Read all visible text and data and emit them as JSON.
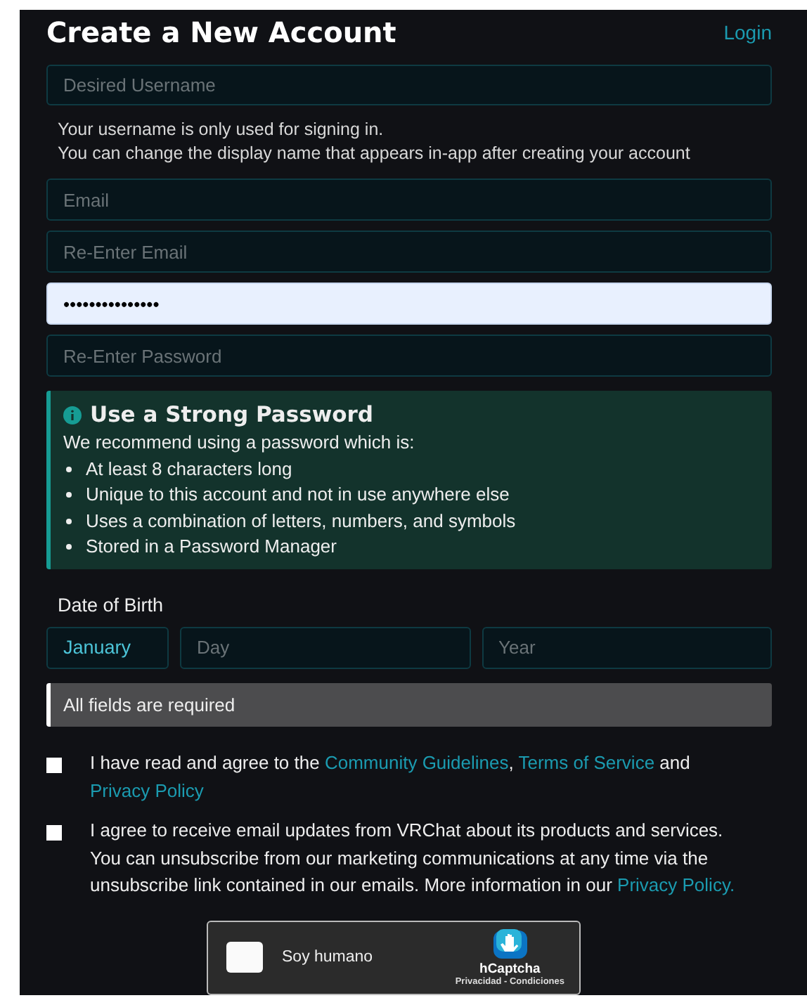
{
  "title": "Create a New Account",
  "login_link": "Login",
  "username_field": {
    "placeholder": "Desired Username"
  },
  "username_help": [
    "Your username is only used for signing in.",
    "You can change the display name that appears in-app after creating your account"
  ],
  "fields": [
    {
      "placeholder": "Email",
      "focused": false
    },
    {
      "placeholder": "Re-Enter Email",
      "focused": false
    },
    {
      "value": "•••••••••••••••",
      "focused": true
    },
    {
      "placeholder": "Re-Enter Password",
      "focused": false
    }
  ],
  "password_tip": {
    "title": "Use a Strong Password",
    "intro": "We recommend using a password which is:",
    "items": [
      "At least 8 characters long",
      "Unique to this account and not in use anywhere else",
      "Uses a combination of letters, numbers, and symbols",
      "Stored in a Password Manager"
    ]
  },
  "date_of_birth": {
    "label": "Date of Birth",
    "month": "January",
    "day_placeholder": "Day",
    "year_placeholder": "Year"
  },
  "notice": "All fields are required",
  "agreements": [
    {
      "checked": false,
      "parts": [
        {
          "kind": "text",
          "text": "I have read and agree to the "
        },
        {
          "kind": "link",
          "text": "Community Guidelines"
        },
        {
          "kind": "text",
          "text": ", "
        },
        {
          "kind": "link",
          "text": "Terms of Service"
        },
        {
          "kind": "text",
          "text": " and "
        },
        {
          "kind": "link",
          "text": "Privacy Policy"
        }
      ]
    },
    {
      "checked": false,
      "parts": [
        {
          "kind": "text",
          "text": "I agree to receive email updates from VRChat about its products and services. You can unsubscribe from our marketing communications at any time via the unsubscribe link contained in our emails. More information in our "
        },
        {
          "kind": "link",
          "text": "Privacy Policy."
        }
      ]
    }
  ],
  "captcha": {
    "checked": false,
    "label": "Soy humano",
    "brand": "hCaptcha",
    "links": "Privacidad - Condiciones"
  }
}
